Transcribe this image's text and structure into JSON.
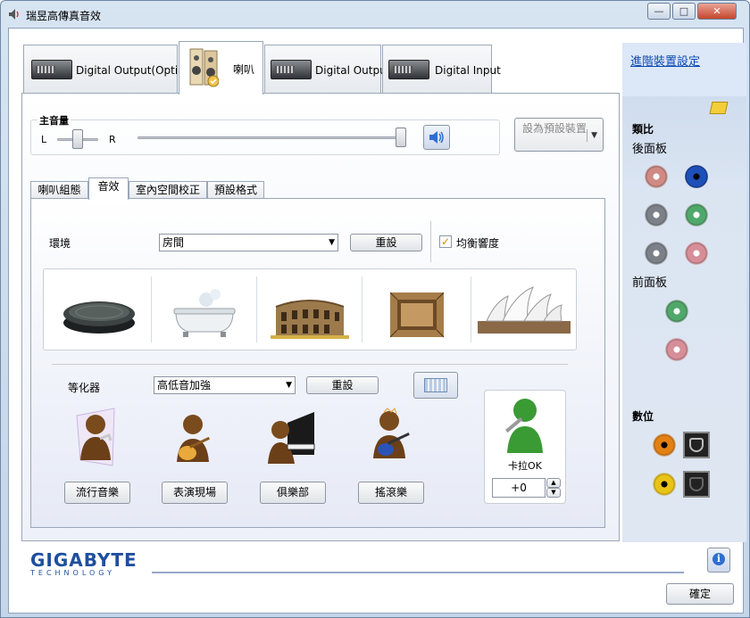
{
  "window": {
    "title": "瑞昱高傳真音效",
    "min": "—",
    "max": "□",
    "close": "✕"
  },
  "main_tabs": [
    {
      "label": "Digital Output(Optical)"
    },
    {
      "label": "喇叭"
    },
    {
      "label": "Digital Output"
    },
    {
      "label": "Digital Input"
    }
  ],
  "master_volume": {
    "label": "主音量",
    "left": "L",
    "right": "R",
    "balance": 0.5,
    "level": 1.0,
    "default_device_label": "設為預設裝置"
  },
  "sub_tabs": [
    {
      "label": "喇叭組態"
    },
    {
      "label": "音效"
    },
    {
      "label": "室內空間校正"
    },
    {
      "label": "預設格式"
    }
  ],
  "environment": {
    "label": "環境",
    "value": "房間",
    "reset": "重設",
    "loudness_label": "均衡響度",
    "loudness_checked": true,
    "presets": [
      {
        "icon": "stone-disc-icon"
      },
      {
        "icon": "bathtub-icon"
      },
      {
        "icon": "colosseum-icon"
      },
      {
        "icon": "padded-cell-icon"
      },
      {
        "icon": "opera-house-icon"
      }
    ]
  },
  "equalizer": {
    "label": "等化器",
    "value": "高低音加強",
    "reset": "重設",
    "presets": [
      {
        "label": "流行音樂",
        "icon": "pop-singer-icon"
      },
      {
        "label": "表演現場",
        "icon": "guitarist-icon"
      },
      {
        "label": "俱樂部",
        "icon": "pianist-icon"
      },
      {
        "label": "搖滾樂",
        "icon": "rock-guitarist-icon"
      }
    ]
  },
  "karaoke": {
    "label": "卡拉OK",
    "value": "+0"
  },
  "side": {
    "advanced_link": "進階裝置設定",
    "analog": "類比",
    "rear_panel": "後面板",
    "front_panel": "前面板",
    "digital": "數位",
    "colors": {
      "pink": "#d08a84",
      "blue": "#1d4fb8",
      "grey": "#7c8088",
      "green": "#4fa86a",
      "rose": "#d68e98",
      "orange": "#e38012",
      "yellow": "#e9c315"
    }
  },
  "brand": {
    "name": "GIGABYTE",
    "sub": "TECHNOLOGY"
  },
  "ok_button": "確定",
  "info_icon": "i"
}
